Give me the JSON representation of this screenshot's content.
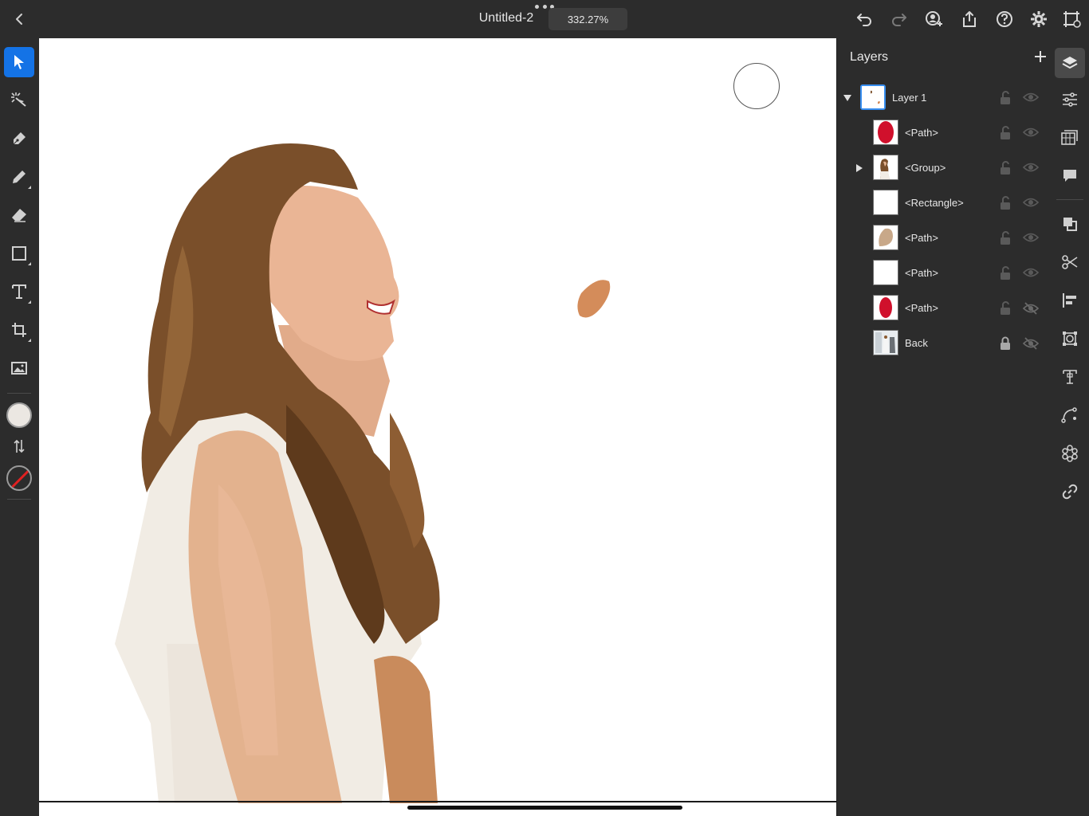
{
  "top_bar": {
    "document_title": "Untitled-2",
    "zoom_level": "332.27%",
    "icons": [
      "back-icon",
      "more-icon",
      "undo-icon",
      "redo-icon",
      "invite-icon",
      "share-icon",
      "help-icon",
      "settings-icon",
      "artboards-icon"
    ]
  },
  "left_toolbar": {
    "tools": [
      "selection-tool",
      "direct-selection-tool",
      "pen-tool",
      "pencil-tool",
      "eraser-tool",
      "shape-tool",
      "type-tool",
      "transform-tool",
      "image-tool"
    ],
    "active_tool": "selection-tool",
    "fill_color": "#ebe7e2",
    "stroke": "none"
  },
  "layers_panel": {
    "title": "Layers",
    "layers": [
      {
        "name": "Layer 1",
        "disclosure": "expanded",
        "thumb": "layer",
        "selected": true,
        "locked": false,
        "visible": true
      },
      {
        "name": "<Path>",
        "disclosure": "none",
        "thumb": "red-oval",
        "selected": false,
        "locked": false,
        "visible": true
      },
      {
        "name": "<Group>",
        "disclosure": "collapsed",
        "thumb": "portrait",
        "selected": false,
        "locked": false,
        "visible": true
      },
      {
        "name": "<Rectangle>",
        "disclosure": "none",
        "thumb": "blank",
        "selected": false,
        "locked": false,
        "visible": true
      },
      {
        "name": "<Path>",
        "disclosure": "none",
        "thumb": "tan-oval",
        "selected": false,
        "locked": false,
        "visible": true
      },
      {
        "name": "<Path>",
        "disclosure": "none",
        "thumb": "blank",
        "selected": false,
        "locked": false,
        "visible": true
      },
      {
        "name": "<Path>",
        "disclosure": "none",
        "thumb": "red-oval-small",
        "selected": false,
        "locked": false,
        "visible": false
      },
      {
        "name": "Back",
        "disclosure": "none",
        "thumb": "photo",
        "selected": false,
        "locked": true,
        "visible": false
      }
    ]
  },
  "right_rail": {
    "buttons": [
      "layers-icon",
      "properties-icon",
      "libraries-icon",
      "comments-icon",
      "arrange-icon",
      "scissors-icon",
      "align-icon",
      "transform-icon",
      "text-panel-icon",
      "path-icon",
      "repeat-icon",
      "link-icon"
    ],
    "active": "layers-icon"
  },
  "colors": {
    "accent": "#1473e6",
    "panel_bg": "#2c2c2c",
    "canvas_bg": "#ffffff"
  }
}
